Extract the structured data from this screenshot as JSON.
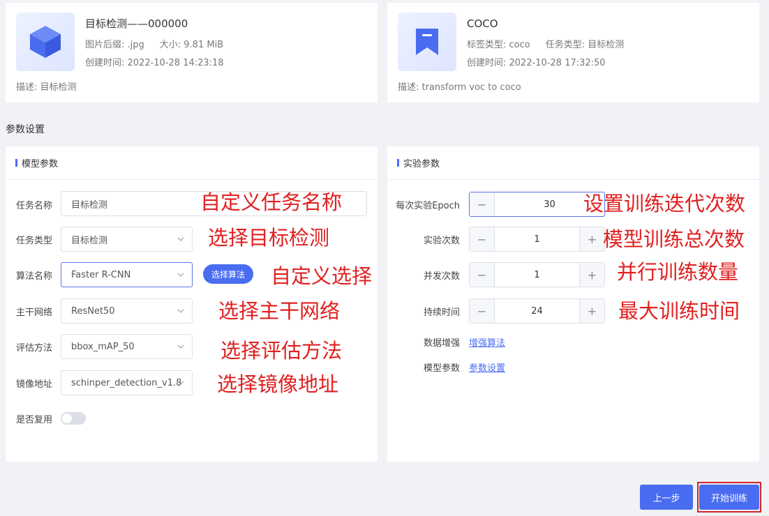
{
  "dataset": {
    "title": "目标检测——000000",
    "suffix": "图片后缀: .jpg",
    "size": "大小: 9.81 MiB",
    "created": "创建时间: 2022-10-28 14:23:18",
    "desc": "描述: 目标检测",
    "icon": "cube-icon",
    "icon_color": "#4a6cf0"
  },
  "label": {
    "title": "COCO",
    "label_type": "标签类型: coco",
    "task_type": "任务类型: 目标检测",
    "created": "创建时间: 2022-10-28 17:32:50",
    "desc": "描述: transform voc to coco",
    "icon": "bookmark-icon"
  },
  "section_title": "参数设置",
  "model_params": {
    "header": "模型参数",
    "task_name_label": "任务名称",
    "task_name_value": "目标检测",
    "task_type_label": "任务类型",
    "task_type_value": "目标检测",
    "algo_label": "算法名称",
    "algo_value": "Faster R-CNN",
    "algo_button": "选择算法",
    "backbone_label": "主干网络",
    "backbone_value": "ResNet50",
    "eval_label": "评估方法",
    "eval_value": "bbox_mAP_50",
    "image_label": "镜像地址",
    "image_value": "schinper_detection_v1.8",
    "reuse_label": "是否复用",
    "reuse_on": false
  },
  "exp_params": {
    "header": "实验参数",
    "epoch_label": "每次实验Epoch",
    "epoch_value": "30",
    "runs_label": "实验次数",
    "runs_value": "1",
    "concurrency_label": "并发次数",
    "concurrency_value": "1",
    "duration_label": "持续时间",
    "duration_value": "24",
    "augment_label": "数据增强",
    "augment_link": "增强算法",
    "model_label": "模型参数",
    "model_link": "参数设置",
    "minus": "−",
    "plus": "+"
  },
  "annotations": {
    "task_name": "自定义任务名称",
    "task_type": "选择目标检测",
    "algo": "自定义选择",
    "backbone": "选择主干网络",
    "eval": "选择评估方法",
    "image": "选择镜像地址",
    "epoch": "设置训练迭代次数",
    "runs": "模型训练总次数",
    "concurrency": "并行训练数量",
    "duration": "最大训练时间"
  },
  "footer": {
    "prev": "上一步",
    "start": "开始训练"
  },
  "colors": {
    "accent": "#4a6cf0",
    "annotation": "#e02020",
    "highlight_border": "#d4232b"
  }
}
